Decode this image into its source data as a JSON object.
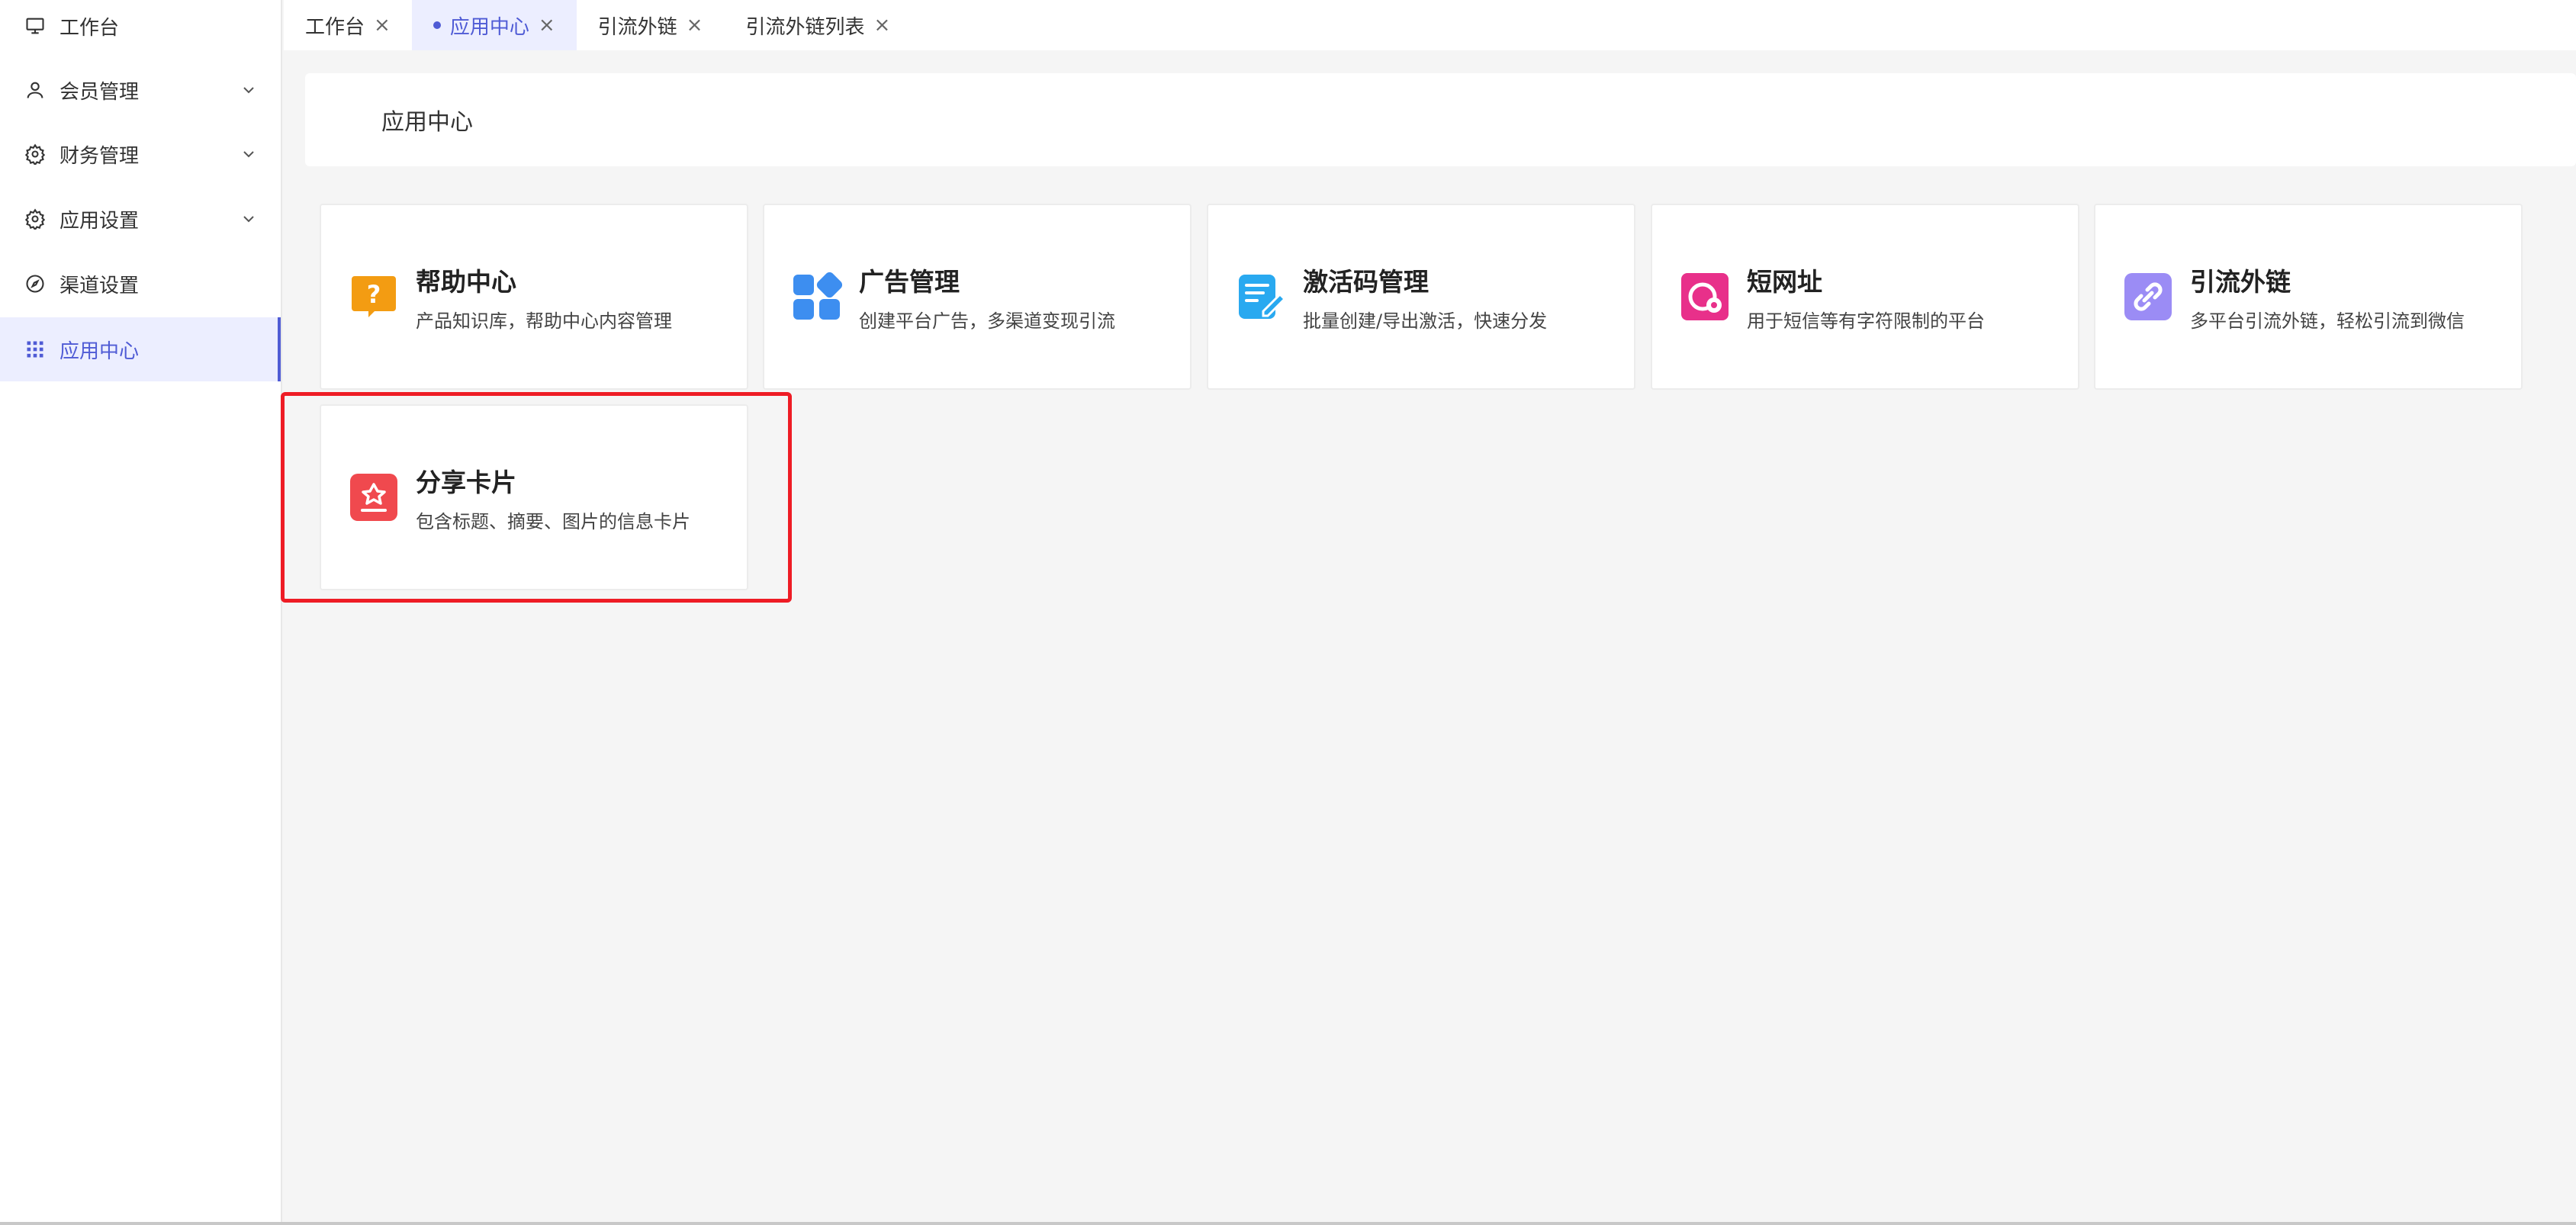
{
  "sidebar": {
    "items": [
      {
        "label": "工作台"
      },
      {
        "label": "会员管理"
      },
      {
        "label": "财务管理"
      },
      {
        "label": "应用设置"
      },
      {
        "label": "渠道设置"
      },
      {
        "label": "应用中心"
      }
    ]
  },
  "tabs": [
    {
      "label": "工作台",
      "close": "×"
    },
    {
      "label": "应用中心",
      "close": "×"
    },
    {
      "label": "引流外链",
      "close": "×"
    },
    {
      "label": "引流外链列表",
      "close": "×"
    }
  ],
  "header": {
    "title": "应用中心"
  },
  "cards": [
    {
      "title": "帮助中心",
      "desc": "产品知识库，帮助中心内容管理",
      "color": "#f39c12",
      "icon": "help-icon"
    },
    {
      "title": "广告管理",
      "desc": "创建平台广告，多渠道变现引流",
      "color": "#3d8ef0",
      "icon": "apps-icon"
    },
    {
      "title": "激活码管理",
      "desc": "批量创建/导出激活，快速分发",
      "color": "#29a9f0",
      "icon": "edit-doc-icon"
    },
    {
      "title": "短网址",
      "desc": "用于短信等有字符限制的平台",
      "color": "#e8308a",
      "icon": "link-gear-icon"
    },
    {
      "title": "引流外链",
      "desc": "多平台引流外链，轻松引流到微信",
      "color": "#9b8cf5",
      "icon": "chain-link-icon"
    },
    {
      "title": "分享卡片",
      "desc": "包含标题、摘要、图片的信息卡片",
      "color": "#f0494e",
      "icon": "share-card-icon"
    }
  ],
  "colors": {
    "accent": "#4f5bd5",
    "highlight": "#ee1c25"
  }
}
